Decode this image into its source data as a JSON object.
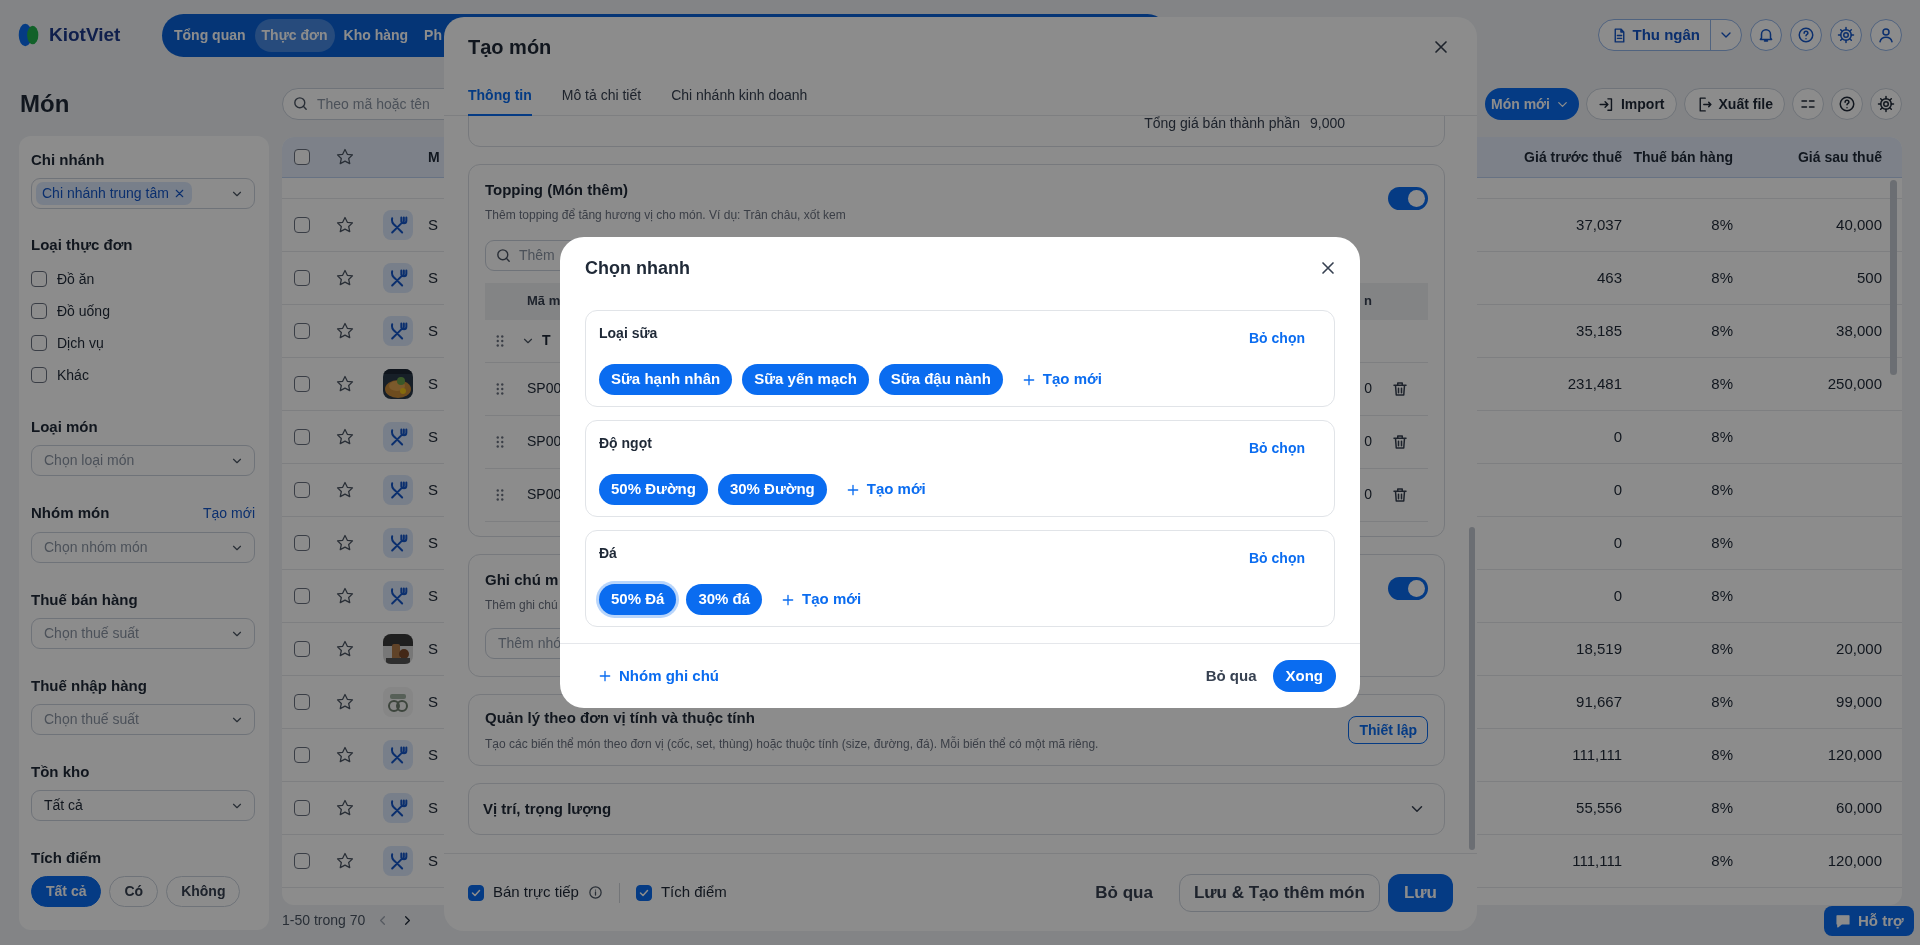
{
  "header": {
    "logo": "KiotViet",
    "nav": [
      {
        "label": "Tổng quan",
        "selected": false
      },
      {
        "label": "Thực đơn",
        "selected": true
      },
      {
        "label": "Kho hàng",
        "selected": false
      },
      {
        "label": "Ph",
        "selected": false
      }
    ],
    "cashier_button": "Thu ngân"
  },
  "page": {
    "title": "Món",
    "search": {
      "placeholder": "Theo mã hoặc tên"
    },
    "actions": [
      {
        "label": "Món mới",
        "kind": "primary"
      },
      {
        "label": "Import",
        "kind": "import"
      },
      {
        "label": "Xuất file",
        "kind": "export"
      }
    ]
  },
  "filters": {
    "branch": {
      "label": "Chi nhánh",
      "value": "Chi nhánh trung tâm"
    },
    "menu_type": {
      "label": "Loại thực đơn",
      "options": [
        {
          "label": "Đồ ăn",
          "checked": false
        },
        {
          "label": "Đồ uống",
          "checked": false
        },
        {
          "label": "Dịch vụ",
          "checked": false
        },
        {
          "label": "Khác",
          "checked": false
        }
      ]
    },
    "selects": [
      {
        "label": "Loại món",
        "placeholder": "Chọn loại món"
      },
      {
        "label": "Nhóm món",
        "link": "Tạo mới",
        "placeholder": "Chọn nhóm món"
      },
      {
        "label": "Thuế bán hàng",
        "placeholder": "Chọn thuế suất"
      },
      {
        "label": "Thuế nhập hàng",
        "placeholder": "Chọn thuế suất"
      },
      {
        "label": "Tồn kho",
        "value": "Tất cả"
      }
    ],
    "points": {
      "label": "Tích điểm",
      "options": [
        {
          "label": "Tất cả",
          "selected": true
        },
        {
          "label": "Có",
          "selected": false
        },
        {
          "label": "Không",
          "selected": false
        }
      ]
    }
  },
  "table": {
    "select_all_checked": false,
    "columns": [
      "M",
      "Giá trước thuế",
      "Thuế bán hàng",
      "Giá sau thuế"
    ],
    "rows": [
      {
        "kind": "utensils",
        "checked": false,
        "code": "S",
        "price_before_tax": "37,037",
        "tax": "8%",
        "price_after_tax": "40,000"
      },
      {
        "kind": "utensils",
        "checked": false,
        "code": "S",
        "price_before_tax": "463",
        "tax": "8%",
        "price_after_tax": "500"
      },
      {
        "kind": "utensils",
        "checked": false,
        "code": "S",
        "price_before_tax": "35,185",
        "tax": "8%",
        "price_after_tax": "38,000"
      },
      {
        "kind": "picture",
        "checked": false,
        "code": "S",
        "price_before_tax": "231,481",
        "tax": "8%",
        "price_after_tax": "250,000"
      },
      {
        "kind": "utensils",
        "checked": false,
        "code": "S",
        "price_before_tax": "0",
        "tax": "8%"
      },
      {
        "kind": "utensils",
        "checked": false,
        "code": "S",
        "price_before_tax": "0",
        "tax": "8%"
      },
      {
        "kind": "utensils",
        "checked": false,
        "code": "S",
        "price_before_tax": "0",
        "tax": "8%"
      },
      {
        "kind": "utensils",
        "checked": false,
        "code": "S",
        "price_before_tax": "0",
        "tax": "8%"
      },
      {
        "kind": "picture",
        "checked": false,
        "code": "S",
        "price_before_tax": "18,519",
        "tax": "8%",
        "price_after_tax": "20,000"
      },
      {
        "kind": "picture",
        "checked": false,
        "code": "S",
        "price_before_tax": "91,667",
        "tax": "8%",
        "price_after_tax": "99,000"
      },
      {
        "kind": "utensils",
        "checked": false,
        "code": "S",
        "price_before_tax": "111,111",
        "tax": "8%",
        "price_after_tax": "120,000"
      },
      {
        "kind": "utensils",
        "checked": false,
        "code": "S",
        "price_before_tax": "55,556",
        "tax": "8%",
        "price_after_tax": "60,000"
      },
      {
        "kind": "utensils",
        "checked": false,
        "code": "S",
        "price_before_tax": "111,111",
        "tax": "8%",
        "price_after_tax": "120,000"
      }
    ]
  },
  "pagination": "1-50 trong 70",
  "support_button": "Hỗ trợ",
  "create_dialog": {
    "title": "Tạo món",
    "tabs": [
      {
        "label": "Thông tin",
        "selected": true
      },
      {
        "label": "Mô tả chi tiết",
        "selected": false
      },
      {
        "label": "Chi nhánh kinh doanh",
        "selected": false
      }
    ],
    "total": {
      "label": "Tổng giá bán thành phần",
      "value": "9,000"
    },
    "topping": {
      "title": "Topping (Món thêm)",
      "description": "Thêm topping để tăng hương vị cho món. Ví dụ: Trân châu, xốt kem",
      "on": true,
      "search_placeholder": "Thêm",
      "columns": [
        "Mã m",
        "n"
      ],
      "group": {
        "name": "T",
        "expanded": true
      },
      "rows": [
        {
          "code": "SP00",
          "column_2": "0"
        },
        {
          "code": "SP00",
          "column_2": "0"
        },
        {
          "code": "SP00",
          "column_2": "0"
        }
      ]
    },
    "notes": {
      "title": "Ghi chú m",
      "description": "Thêm ghi chú",
      "on": true,
      "input_placeholder": "Thêm nhó"
    },
    "variants": {
      "title": "Quản lý theo đơn vị tính và thuộc tính",
      "description": "Tạo các biến thể món theo đơn vị (cốc, set, thùng) hoặc thuộc tính (size, đường, đá). Mỗi biến thể có một mã riêng.",
      "button": "Thiết lập"
    },
    "position": {
      "title": "Vị trí, trọng lượng",
      "expanded": false
    },
    "footer": {
      "checks": [
        {
          "label": "Bán trực tiếp",
          "checked": true,
          "info": true
        },
        {
          "label": "Tích điểm",
          "checked": true,
          "info": false
        }
      ],
      "buttons": [
        {
          "label": "Bỏ qua",
          "kind": "text"
        },
        {
          "label": "Lưu & Tạo thêm món",
          "kind": "outline"
        },
        {
          "label": "Lưu",
          "kind": "primary"
        }
      ]
    }
  },
  "quick_pick": {
    "title": "Chọn nhanh",
    "groups": [
      {
        "name": "Loại sữa",
        "clear": "Bỏ chọn",
        "options": [
          {
            "label": "Sữa hạnh nhân",
            "focused": false
          },
          {
            "label": "Sữa yến mạch",
            "focused": false
          },
          {
            "label": "Sữa đậu nành",
            "focused": false
          }
        ],
        "add": "Tạo mới"
      },
      {
        "name": "Độ ngọt",
        "clear": "Bỏ chọn",
        "options": [
          {
            "label": "50% Đường",
            "focused": false
          },
          {
            "label": "30% Đường",
            "focused": false
          }
        ],
        "add": "Tạo mới"
      },
      {
        "name": "Đá",
        "clear": "Bỏ chọn",
        "options": [
          {
            "label": "50% Đá",
            "focused": true
          },
          {
            "label": "30% đá",
            "focused": false
          }
        ],
        "add": "Tạo mới"
      }
    ],
    "add_group": "Nhóm ghi chú",
    "buttons": [
      {
        "label": "Bỏ qua",
        "kind": "text"
      },
      {
        "label": "Xong",
        "kind": "primary"
      }
    ]
  }
}
